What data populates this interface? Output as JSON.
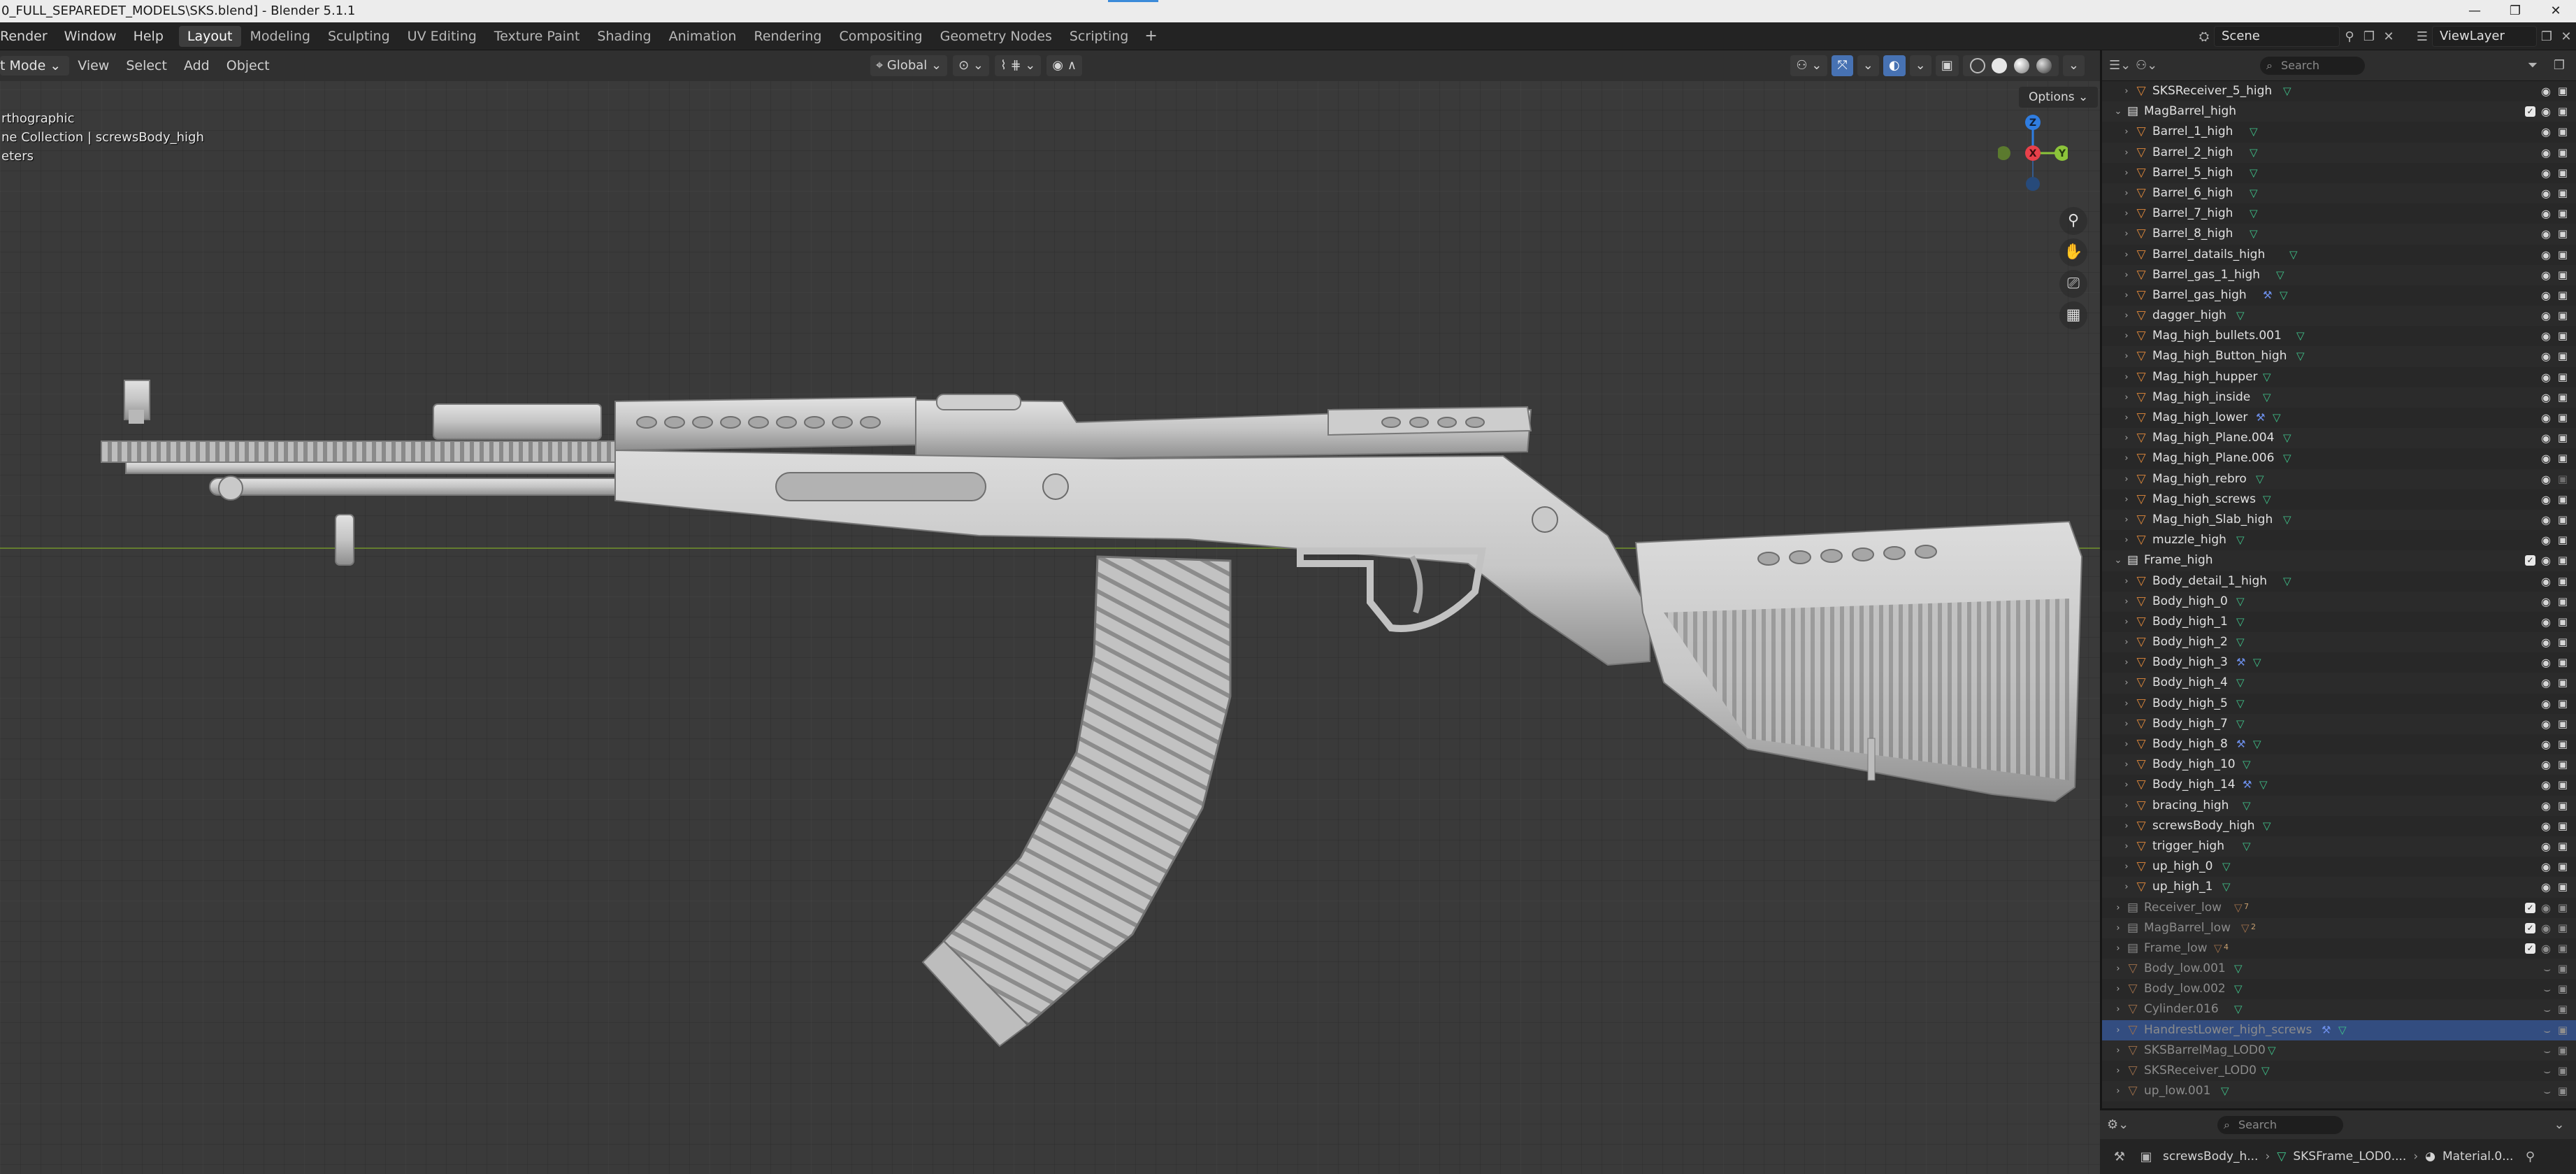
{
  "window": {
    "title": "0_FULL_SEPAREDET_MODELS\\SKS.blend] - Blender 5.1.1",
    "controls": [
      "—",
      "❐",
      "✕"
    ]
  },
  "menubar": {
    "menus": [
      "Render",
      "Window",
      "Help"
    ],
    "workspaces": [
      "Layout",
      "Modeling",
      "Sculpting",
      "UV Editing",
      "Texture Paint",
      "Shading",
      "Animation",
      "Rendering",
      "Compositing",
      "Geometry Nodes",
      "Scripting"
    ],
    "active_workspace": "Layout",
    "add_workspace": "+",
    "scene": "Scene",
    "view_layer": "ViewLayer"
  },
  "viewport_header": {
    "mode": "t Mode",
    "menus": [
      "View",
      "Select",
      "Add",
      "Object"
    ],
    "transform_orientation": "Global",
    "options_label": "Options"
  },
  "viewport": {
    "overlay_lines": [
      "rthographic",
      "ne Collection | screwsBody_high",
      "eters"
    ],
    "gizmo": {
      "z": "Z",
      "x": "X",
      "y": "Y",
      "z_color": "#2f7de1",
      "x_color": "#e8404a",
      "y_color": "#8cc43a"
    }
  },
  "outliner": {
    "search_placeholder": "Search",
    "rows": [
      {
        "name": "SKSReceiver_5_high",
        "depth": 2,
        "kind": "object",
        "badges": [
          "mesh"
        ]
      },
      {
        "name": "MagBarrel_high",
        "depth": 1,
        "kind": "collection",
        "expanded": true,
        "checkbox": true
      },
      {
        "name": "Barrel_1_high",
        "depth": 2,
        "kind": "object",
        "badges": [
          "mesh"
        ]
      },
      {
        "name": "Barrel_2_high",
        "depth": 2,
        "kind": "object",
        "badges": [
          "mesh"
        ]
      },
      {
        "name": "Barrel_5_high",
        "depth": 2,
        "kind": "object",
        "badges": [
          "mesh"
        ]
      },
      {
        "name": "Barrel_6_high",
        "depth": 2,
        "kind": "object",
        "badges": [
          "mesh"
        ]
      },
      {
        "name": "Barrel_7_high",
        "depth": 2,
        "kind": "object",
        "badges": [
          "mesh"
        ]
      },
      {
        "name": "Barrel_8_high",
        "depth": 2,
        "kind": "object",
        "badges": [
          "mesh"
        ]
      },
      {
        "name": "Barrel_datails_high",
        "depth": 2,
        "kind": "object",
        "badges": [
          "mesh"
        ]
      },
      {
        "name": "Barrel_gas_1_high",
        "depth": 2,
        "kind": "object",
        "badges": [
          "mesh"
        ]
      },
      {
        "name": "Barrel_gas_high",
        "depth": 2,
        "kind": "object",
        "badges": [
          "modifier",
          "mesh"
        ]
      },
      {
        "name": "dagger_high",
        "depth": 2,
        "kind": "object",
        "badges": [
          "mesh"
        ]
      },
      {
        "name": "Mag_high_bullets.001",
        "depth": 2,
        "kind": "object",
        "badges": [
          "mesh"
        ]
      },
      {
        "name": "Mag_high_Button_high",
        "depth": 2,
        "kind": "object",
        "badges": [
          "mesh"
        ]
      },
      {
        "name": "Mag_high_hupper",
        "depth": 2,
        "kind": "object",
        "badges": [
          "mesh"
        ]
      },
      {
        "name": "Mag_high_inside",
        "depth": 2,
        "kind": "object",
        "badges": [
          "mesh"
        ]
      },
      {
        "name": "Mag_high_lower",
        "depth": 2,
        "kind": "object",
        "badges": [
          "modifier",
          "mesh"
        ]
      },
      {
        "name": "Mag_high_Plane.004",
        "depth": 2,
        "kind": "object",
        "badges": [
          "mesh"
        ]
      },
      {
        "name": "Mag_high_Plane.006",
        "depth": 2,
        "kind": "object",
        "badges": [
          "mesh"
        ]
      },
      {
        "name": "Mag_high_rebro",
        "depth": 2,
        "kind": "object",
        "badges": [
          "mesh"
        ],
        "hidden_render": true
      },
      {
        "name": "Mag_high_screws",
        "depth": 2,
        "kind": "object",
        "badges": [
          "mesh"
        ]
      },
      {
        "name": "Mag_high_Slab_high",
        "depth": 2,
        "kind": "object",
        "badges": [
          "mesh"
        ]
      },
      {
        "name": "muzzle_high",
        "depth": 2,
        "kind": "object",
        "badges": [
          "mesh"
        ]
      },
      {
        "name": "Frame_high",
        "depth": 1,
        "kind": "collection",
        "expanded": true,
        "checkbox": true
      },
      {
        "name": "Body_detail_1_high",
        "depth": 2,
        "kind": "object",
        "badges": [
          "mesh"
        ]
      },
      {
        "name": "Body_high_0",
        "depth": 2,
        "kind": "object",
        "badges": [
          "mesh"
        ]
      },
      {
        "name": "Body_high_1",
        "depth": 2,
        "kind": "object",
        "badges": [
          "mesh"
        ]
      },
      {
        "name": "Body_high_2",
        "depth": 2,
        "kind": "object",
        "badges": [
          "mesh"
        ]
      },
      {
        "name": "Body_high_3",
        "depth": 2,
        "kind": "object",
        "badges": [
          "modifier",
          "mesh"
        ]
      },
      {
        "name": "Body_high_4",
        "depth": 2,
        "kind": "object",
        "badges": [
          "mesh"
        ]
      },
      {
        "name": "Body_high_5",
        "depth": 2,
        "kind": "object",
        "badges": [
          "mesh"
        ]
      },
      {
        "name": "Body_high_7",
        "depth": 2,
        "kind": "object",
        "badges": [
          "mesh"
        ]
      },
      {
        "name": "Body_high_8",
        "depth": 2,
        "kind": "object",
        "badges": [
          "modifier",
          "mesh"
        ]
      },
      {
        "name": "Body_high_10",
        "depth": 2,
        "kind": "object",
        "badges": [
          "mesh"
        ]
      },
      {
        "name": "Body_high_14",
        "depth": 2,
        "kind": "object",
        "badges": [
          "modifier",
          "mesh"
        ]
      },
      {
        "name": "bracing_high",
        "depth": 2,
        "kind": "object",
        "badges": [
          "mesh"
        ]
      },
      {
        "name": "screwsBody_high",
        "depth": 2,
        "kind": "object",
        "badges": [
          "mesh"
        ],
        "active": true
      },
      {
        "name": "trigger_high",
        "depth": 2,
        "kind": "object",
        "badges": [
          "mesh"
        ]
      },
      {
        "name": "up_high_0",
        "depth": 2,
        "kind": "object",
        "badges": [
          "mesh"
        ]
      },
      {
        "name": "up_high_1",
        "depth": 2,
        "kind": "object",
        "badges": [
          "mesh"
        ]
      },
      {
        "name": "Receiver_low",
        "depth": 1,
        "kind": "collection",
        "dim": true,
        "checkbox": true,
        "badges": [
          "mesh-count"
        ],
        "count": "7"
      },
      {
        "name": "MagBarrel_low",
        "depth": 1,
        "kind": "collection",
        "dim": true,
        "checkbox": true,
        "badges": [
          "mesh-count"
        ],
        "count": "2"
      },
      {
        "name": "Frame_low",
        "depth": 1,
        "kind": "collection",
        "dim": true,
        "checkbox": true,
        "badges": [
          "mesh-count"
        ],
        "count": "4"
      },
      {
        "name": "Body_low.001",
        "depth": 1,
        "kind": "object",
        "dim": true,
        "badges": [
          "mesh"
        ]
      },
      {
        "name": "Body_low.002",
        "depth": 1,
        "kind": "object",
        "dim": true,
        "badges": [
          "mesh"
        ]
      },
      {
        "name": "Cylinder.016",
        "depth": 1,
        "kind": "object",
        "dim": true,
        "badges": [
          "mesh"
        ]
      },
      {
        "name": "HandrestLower_high_screws",
        "depth": 1,
        "kind": "object",
        "dim": true,
        "selected": true,
        "badges": [
          "modifier",
          "mesh"
        ]
      },
      {
        "name": "SKSBarrelMag_LOD0",
        "depth": 1,
        "kind": "object",
        "dim": true,
        "badges": [
          "mesh"
        ]
      },
      {
        "name": "SKSReceiver_LOD0",
        "depth": 1,
        "kind": "object",
        "dim": true,
        "badges": [
          "mesh"
        ]
      },
      {
        "name": "up_low.001",
        "depth": 1,
        "kind": "object",
        "dim": true,
        "badges": [
          "mesh"
        ]
      }
    ]
  },
  "properties": {
    "search_placeholder": "Search",
    "breadcrumb": [
      "screwsBody_h...",
      "SKSFrame_LOD0....",
      "Material.0..."
    ]
  },
  "colors": {
    "object_icon": "#e0883a",
    "mesh_badge": "#3fc28a",
    "modifier_badge": "#6c8ee8",
    "selection": "#334d80",
    "active_tab": "#3d3d3d"
  }
}
